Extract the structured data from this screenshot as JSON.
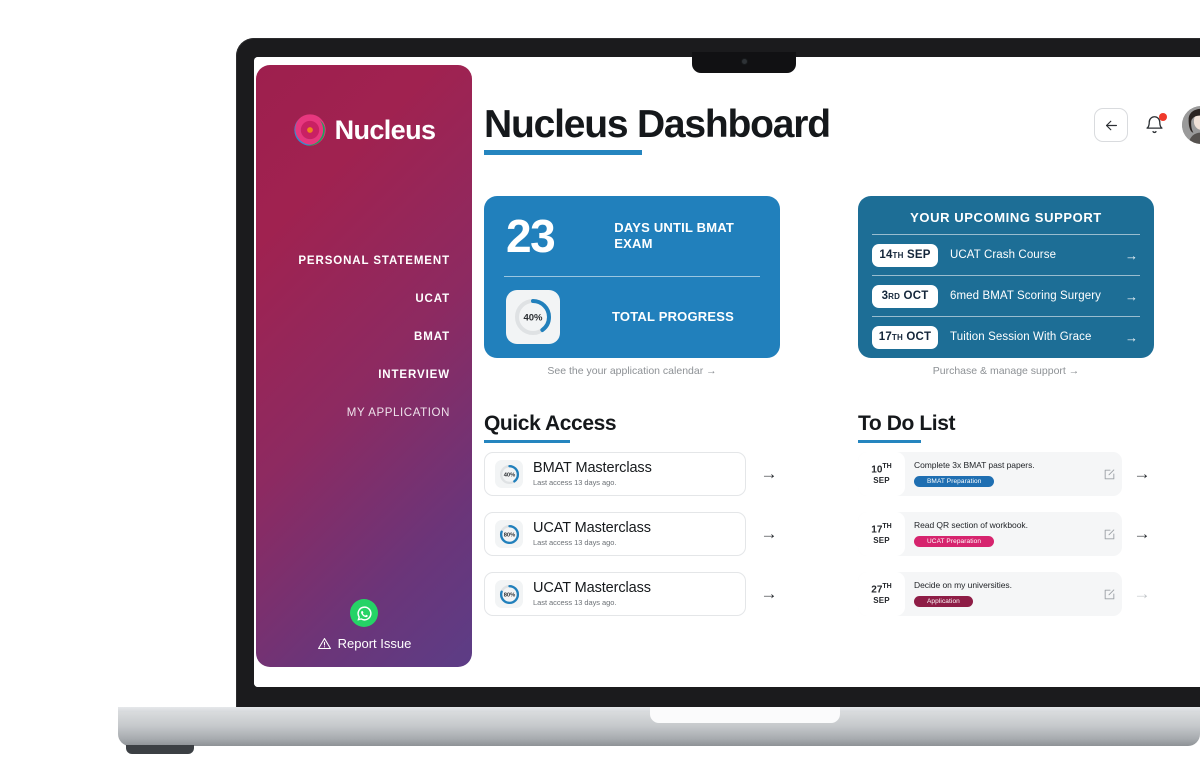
{
  "sidebar": {
    "brand": "Nucleus",
    "nav_items": [
      {
        "label": "PERSONAL STATEMENT",
        "muted": false
      },
      {
        "label": "UCAT",
        "muted": false
      },
      {
        "label": "BMAT",
        "muted": false
      },
      {
        "label": "INTERVIEW",
        "muted": false
      },
      {
        "label": "MY APPLICATION",
        "muted": true
      }
    ],
    "whatsapp_icon": "whatsapp-icon",
    "report_label": "Report Issue",
    "report_icon": "warning-triangle-icon",
    "gradient_from": "#9e1f4e",
    "gradient_to": "#5c3d86"
  },
  "header": {
    "title": "Nucleus Dashboard",
    "back_icon": "arrow-left-icon",
    "bell_icon": "bell-icon",
    "bell_badge_color": "#f0392b",
    "avatar_icon": "user-avatar"
  },
  "exam_card": {
    "days": "23",
    "days_label": "DAYS UNTIL BMAT EXAM",
    "progress_value": "40%",
    "progress_percent": 40,
    "progress_label": "TOTAL PROGRESS",
    "link": "See the your application calendar →",
    "bg": "#2180bc"
  },
  "support_card": {
    "title": "YOUR UPCOMING SUPPORT",
    "link": "Purchase & manage support →",
    "bg": "#1d6e96",
    "items": [
      {
        "day": "14",
        "suffix": "TH",
        "month": "SEP",
        "title": "UCAT Crash Course",
        "arrow": "→"
      },
      {
        "day": "3",
        "suffix": "RD",
        "month": "OCT",
        "title": "6med BMAT Scoring Surgery",
        "arrow": "→"
      },
      {
        "day": "17",
        "suffix": "TH",
        "month": "OCT",
        "title": "Tuition Session With Grace",
        "arrow": "→"
      }
    ]
  },
  "quick_access": {
    "title": "Quick Access",
    "items": [
      {
        "percent": "40%",
        "value": 40,
        "name": "BMAT Masterclass",
        "sub": "Last access 13 days ago.",
        "arrow": "→"
      },
      {
        "percent": "80%",
        "value": 80,
        "name": "UCAT Masterclass",
        "sub": "Last access 13 days ago.",
        "arrow": "→"
      },
      {
        "percent": "80%",
        "value": 80,
        "name": "UCAT Masterclass",
        "sub": "Last access 13 days ago.",
        "arrow": "→"
      }
    ]
  },
  "todo": {
    "title": "To Do List",
    "items": [
      {
        "day": "10",
        "suffix": "TH",
        "month": "SEP",
        "text": "Complete 3x BMAT past papers.",
        "badge": "BMAT Preparation",
        "badge_color": "#1f6fb2",
        "arrow": "→",
        "arrow_dim": false,
        "edit_icon": "edit-square-icon"
      },
      {
        "day": "17",
        "suffix": "TH",
        "month": "SEP",
        "text": "Read QR section of workbook.",
        "badge": "UCAT Preparation",
        "badge_color": "#d6246e",
        "arrow": "→",
        "arrow_dim": false,
        "edit_icon": "edit-square-icon"
      },
      {
        "day": "27",
        "suffix": "TH",
        "month": "SEP",
        "text": "Decide on my universities.",
        "badge": "Application",
        "badge_color": "#8e1d46",
        "arrow": "→",
        "arrow_dim": true,
        "edit_icon": "edit-square-icon"
      }
    ]
  },
  "device": {
    "camera_icon": "webcam-icon"
  }
}
